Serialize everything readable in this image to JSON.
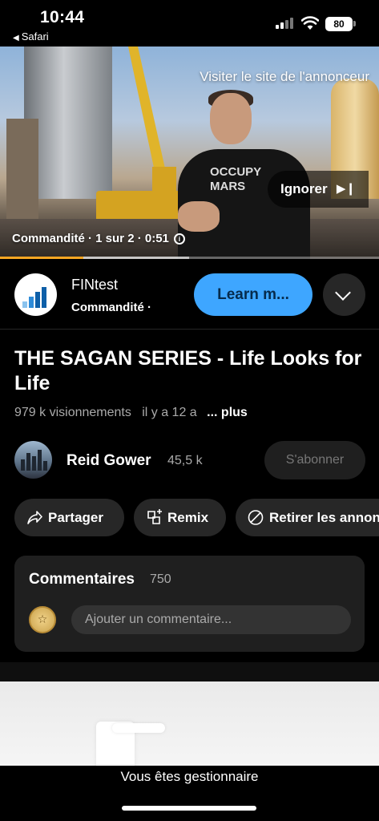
{
  "status_bar": {
    "time": "10:44",
    "back_app": "Safari",
    "battery": "80"
  },
  "video": {
    "visit_advertiser": "Visiter le site de l'annonceur",
    "skip_label": "Ignorer",
    "ad_meta": "Commandité · 1 sur 2 · 0:51",
    "shirt_text": "OCCUPY\nMARS",
    "progress": 0.22,
    "buffered": 0.5
  },
  "advertiser": {
    "name": "FINtest",
    "sublabel": "Commandité ·",
    "cta": "Learn m..."
  },
  "video_info": {
    "title": "THE SAGAN SERIES - Life Looks for Life",
    "views": "979 k visionnements",
    "age": "il y a 12 a",
    "more": "... plus"
  },
  "channel": {
    "name": "Reid Gower",
    "subscribers": "45,5 k",
    "subscribe_label": "S'abonner"
  },
  "actions": [
    {
      "label": "Partager",
      "icon": "share-icon"
    },
    {
      "label": "Remix",
      "icon": "remix-icon"
    },
    {
      "label": "Retirer les annonces",
      "icon": "block-icon"
    }
  ],
  "comments": {
    "title": "Commentaires",
    "count": "750",
    "placeholder": "Ajouter un commentaire..."
  },
  "bottom": {
    "manager_text": "Vous êtes gestionnaire"
  },
  "colors": {
    "accent_blue": "#3ea6ff",
    "progress": "#f5a623",
    "background": "#000000"
  }
}
